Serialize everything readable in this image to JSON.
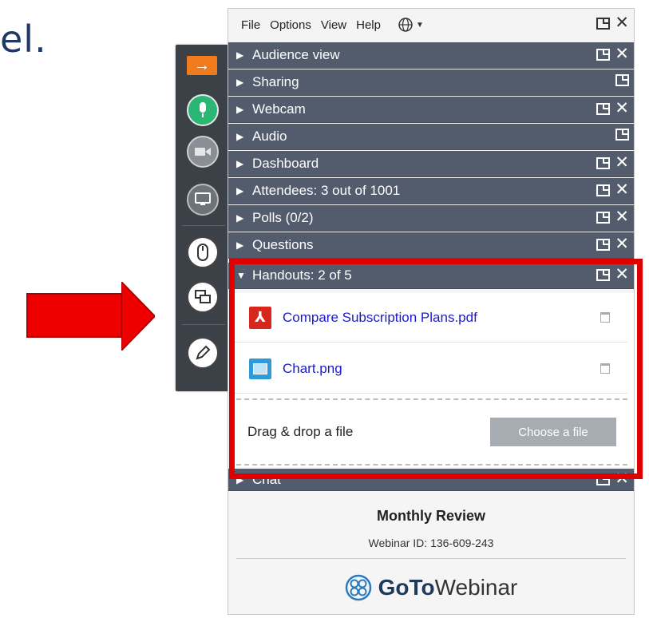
{
  "slide": {
    "text": "el."
  },
  "menubar": {
    "items": [
      "File",
      "Options",
      "View",
      "Help"
    ]
  },
  "sections": [
    {
      "label": "Audience view",
      "expanded": false,
      "closable": true
    },
    {
      "label": "Sharing",
      "expanded": false,
      "closable": false
    },
    {
      "label": "Webcam",
      "expanded": false,
      "closable": true
    },
    {
      "label": "Audio",
      "expanded": false,
      "closable": false
    },
    {
      "label": "Dashboard",
      "expanded": false,
      "closable": true
    },
    {
      "label": "Attendees: 3 out of 1001",
      "expanded": false,
      "closable": true
    },
    {
      "label": "Polls (0/2)",
      "expanded": false,
      "closable": true
    },
    {
      "label": "Questions",
      "expanded": false,
      "closable": true
    },
    {
      "label": "Handouts: 2 of 5",
      "expanded": true,
      "closable": true
    },
    {
      "label": "Chat",
      "expanded": false,
      "closable": true
    }
  ],
  "handouts": {
    "files": [
      {
        "name": "Compare Subscription Plans.pdf",
        "type": "pdf-icon"
      },
      {
        "name": "Chart.png",
        "type": "image-icon"
      }
    ],
    "drop_label": "Drag & drop a file",
    "choose_label": "Choose a file"
  },
  "footer": {
    "title": "Monthly Review",
    "webinar_id": "Webinar ID: 136-609-243",
    "brand_bold": "GoTo",
    "brand_rest": "Webinar"
  },
  "colors": {
    "toolbar": "#3c4148",
    "orange": "#f07b1d",
    "mic_green": "#2bb673",
    "section_bg": "#535c6c",
    "highlight": "#e00000",
    "arrow": "#ee0000",
    "link": "#1d1bc8"
  }
}
